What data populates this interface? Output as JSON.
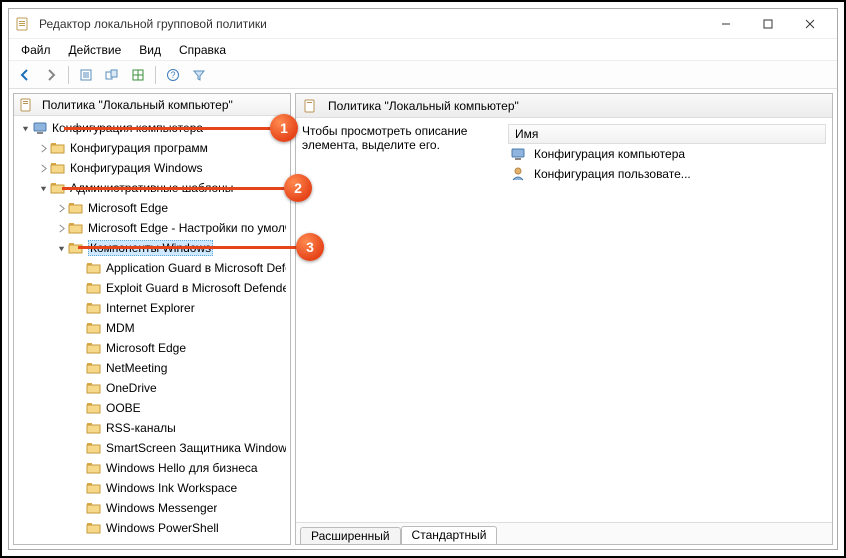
{
  "window": {
    "title": "Редактор локальной групповой политики"
  },
  "menus": [
    "Файл",
    "Действие",
    "Вид",
    "Справка"
  ],
  "tree": {
    "root": "Политика \"Локальный компьютер\"",
    "n_comp_conf": "Конфигурация компьютера",
    "n_prog_conf": "Конфигурация программ",
    "n_win_conf": "Конфигурация Windows",
    "n_admin_tmpl": "Административные шаблоны",
    "n_edge1": "Microsoft Edge",
    "n_edge2": "Microsoft Edge - Настройки по умолчанию",
    "n_wincomp": "Компоненты Windows",
    "leaves": [
      "Application Guard в Microsoft Defender",
      "Exploit Guard в Microsoft Defender",
      "Internet Explorer",
      "MDM",
      "Microsoft Edge",
      "NetMeeting",
      "OneDrive",
      "OOBE",
      "RSS-каналы",
      "SmartScreen Защитника Windows",
      "Windows Hello для бизнеса",
      "Windows Ink Workspace",
      "Windows Messenger",
      "Windows PowerShell"
    ]
  },
  "content": {
    "heading": "Политика \"Локальный компьютер\"",
    "description": "Чтобы просмотреть описание элемента, выделите его.",
    "col_name": "Имя",
    "items": [
      "Конфигурация компьютера",
      "Конфигурация пользовате..."
    ],
    "tab_ext": "Расширенный",
    "tab_std": "Стандартный"
  },
  "annotations": {
    "b1": "1",
    "b2": "2",
    "b3": "3"
  }
}
